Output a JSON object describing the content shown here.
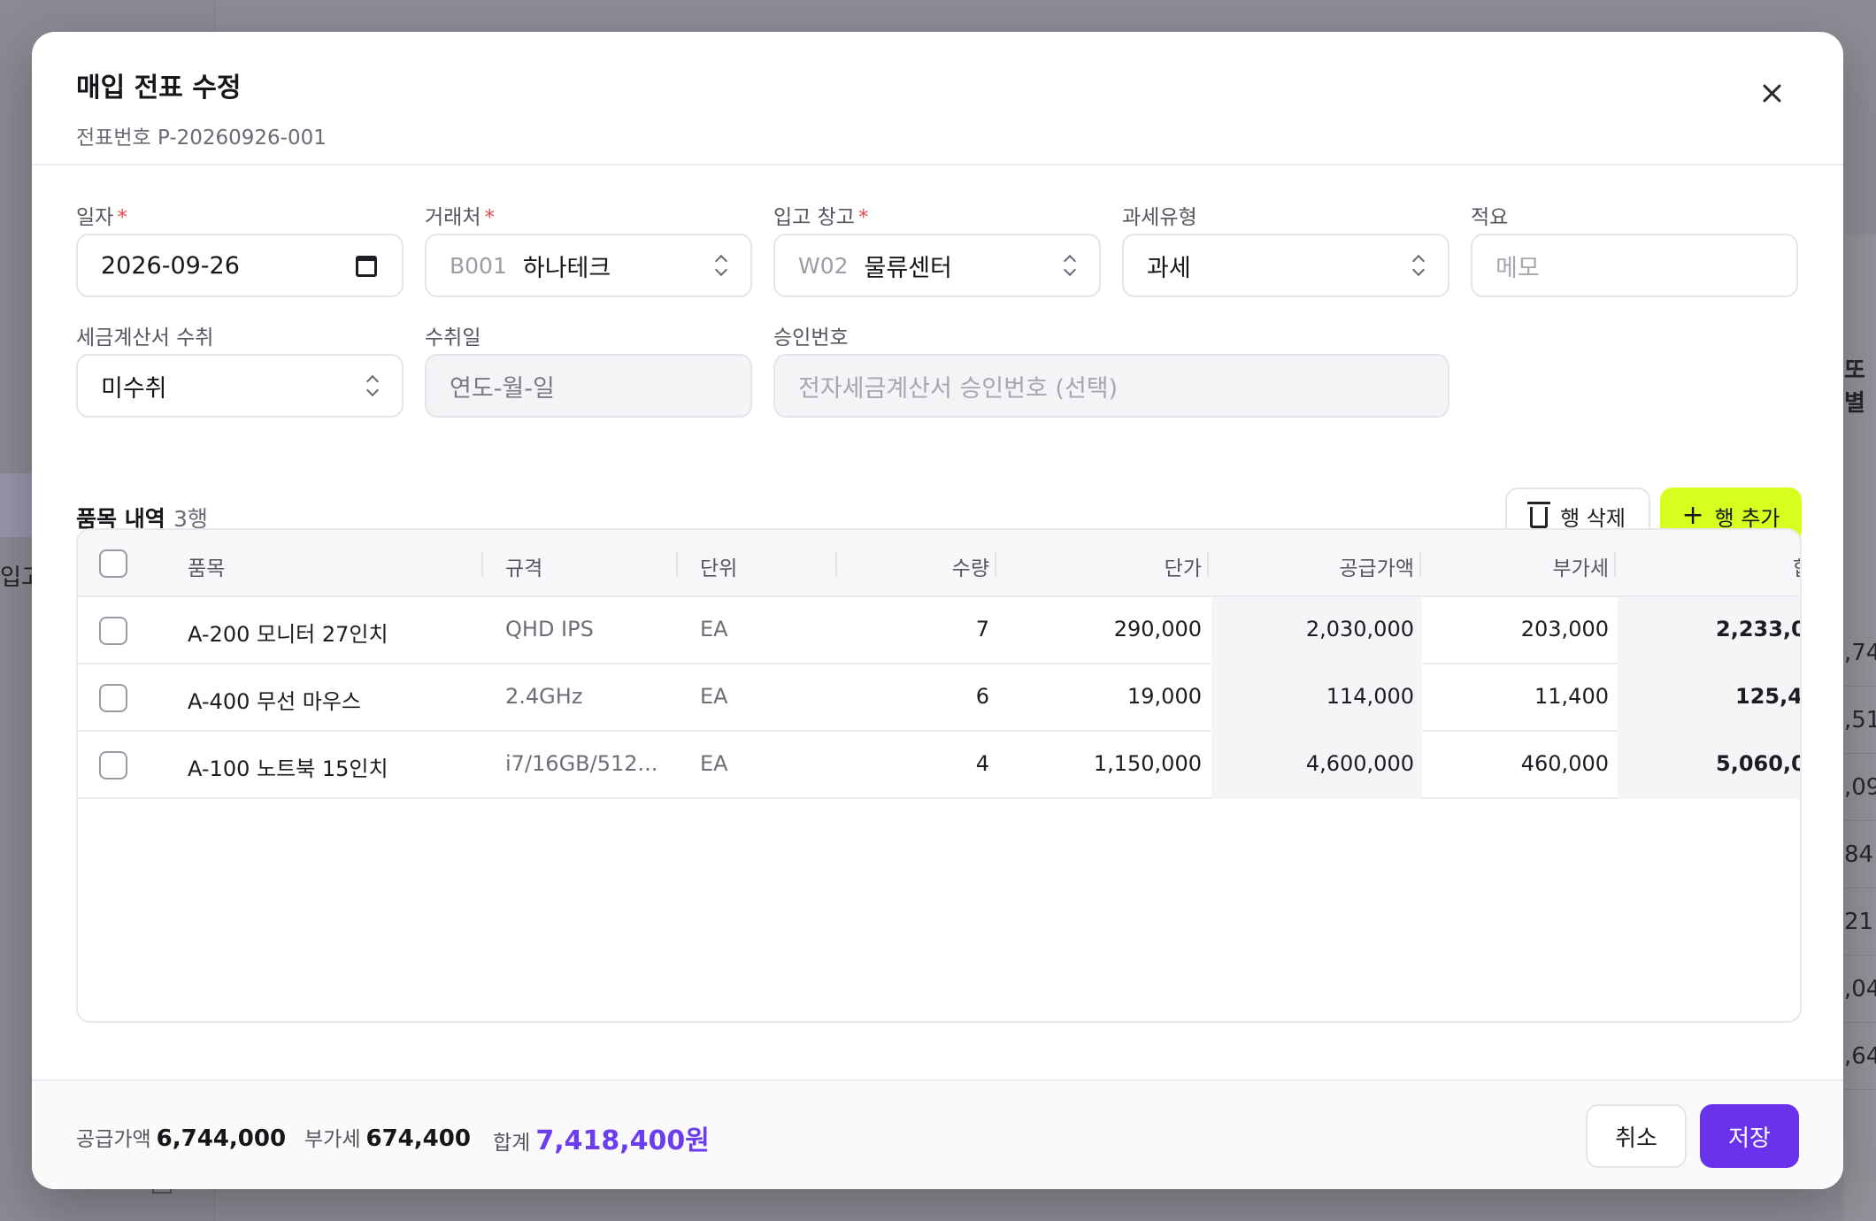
{
  "background": {
    "sidebar_text": "입고",
    "right_label": "또별",
    "right_numbers": [
      ",74",
      ",51",
      ",09",
      "84",
      "21",
      ",04",
      ",64"
    ]
  },
  "modal": {
    "title": "매입 전표 수정",
    "subtitle": "전표번호 P-20260926-001"
  },
  "form": {
    "date": {
      "label": "일자",
      "value": "2026-09-26"
    },
    "vendor": {
      "label": "거래처",
      "code": "B001",
      "value": "하나테크"
    },
    "warehouse": {
      "label": "입고 창고",
      "code": "W02",
      "value": "물류센터"
    },
    "tax_type": {
      "label": "과세유형",
      "value": "과세"
    },
    "memo": {
      "label": "적요",
      "placeholder": "메모"
    },
    "invoice_received": {
      "label": "세금계산서 수취",
      "value": "미수취"
    },
    "received_date": {
      "label": "수취일",
      "placeholder": "연도-월-일"
    },
    "approval_no": {
      "label": "승인번호",
      "placeholder": "전자세금계산서 승인번호 (선택)"
    }
  },
  "items": {
    "title": "품목 내역",
    "count": "3행",
    "delete_label": "행 삭제",
    "add_label": "행 추가",
    "columns": {
      "name": "품목",
      "spec": "규격",
      "unit": "단위",
      "qty": "수량",
      "price": "단가",
      "supply": "공급가액",
      "vat": "부가세",
      "total": "합"
    },
    "rows": [
      {
        "name": "A-200 모니터 27인치",
        "spec": "QHD IPS",
        "unit": "EA",
        "qty": "7",
        "price": "290,000",
        "supply": "2,030,000",
        "vat": "203,000",
        "total": "2,233,0"
      },
      {
        "name": "A-400 무선 마우스",
        "spec": "2.4GHz",
        "unit": "EA",
        "qty": "6",
        "price": "19,000",
        "supply": "114,000",
        "vat": "11,400",
        "total": "125,4"
      },
      {
        "name": "A-100 노트북 15인치",
        "spec": "i7/16GB/512...",
        "unit": "EA",
        "qty": "4",
        "price": "1,150,000",
        "supply": "4,600,000",
        "vat": "460,000",
        "total": "5,060,0"
      }
    ]
  },
  "footer": {
    "supply_label": "공급가액",
    "supply_value": "6,744,000",
    "vat_label": "부가세",
    "vat_value": "674,400",
    "total_label": "합계",
    "total_value": "7,418,400원",
    "cancel_label": "취소",
    "save_label": "저장"
  },
  "colors": {
    "accent": "#6833ea",
    "add_button": "#d6ff1f",
    "required": "#e5484d"
  }
}
